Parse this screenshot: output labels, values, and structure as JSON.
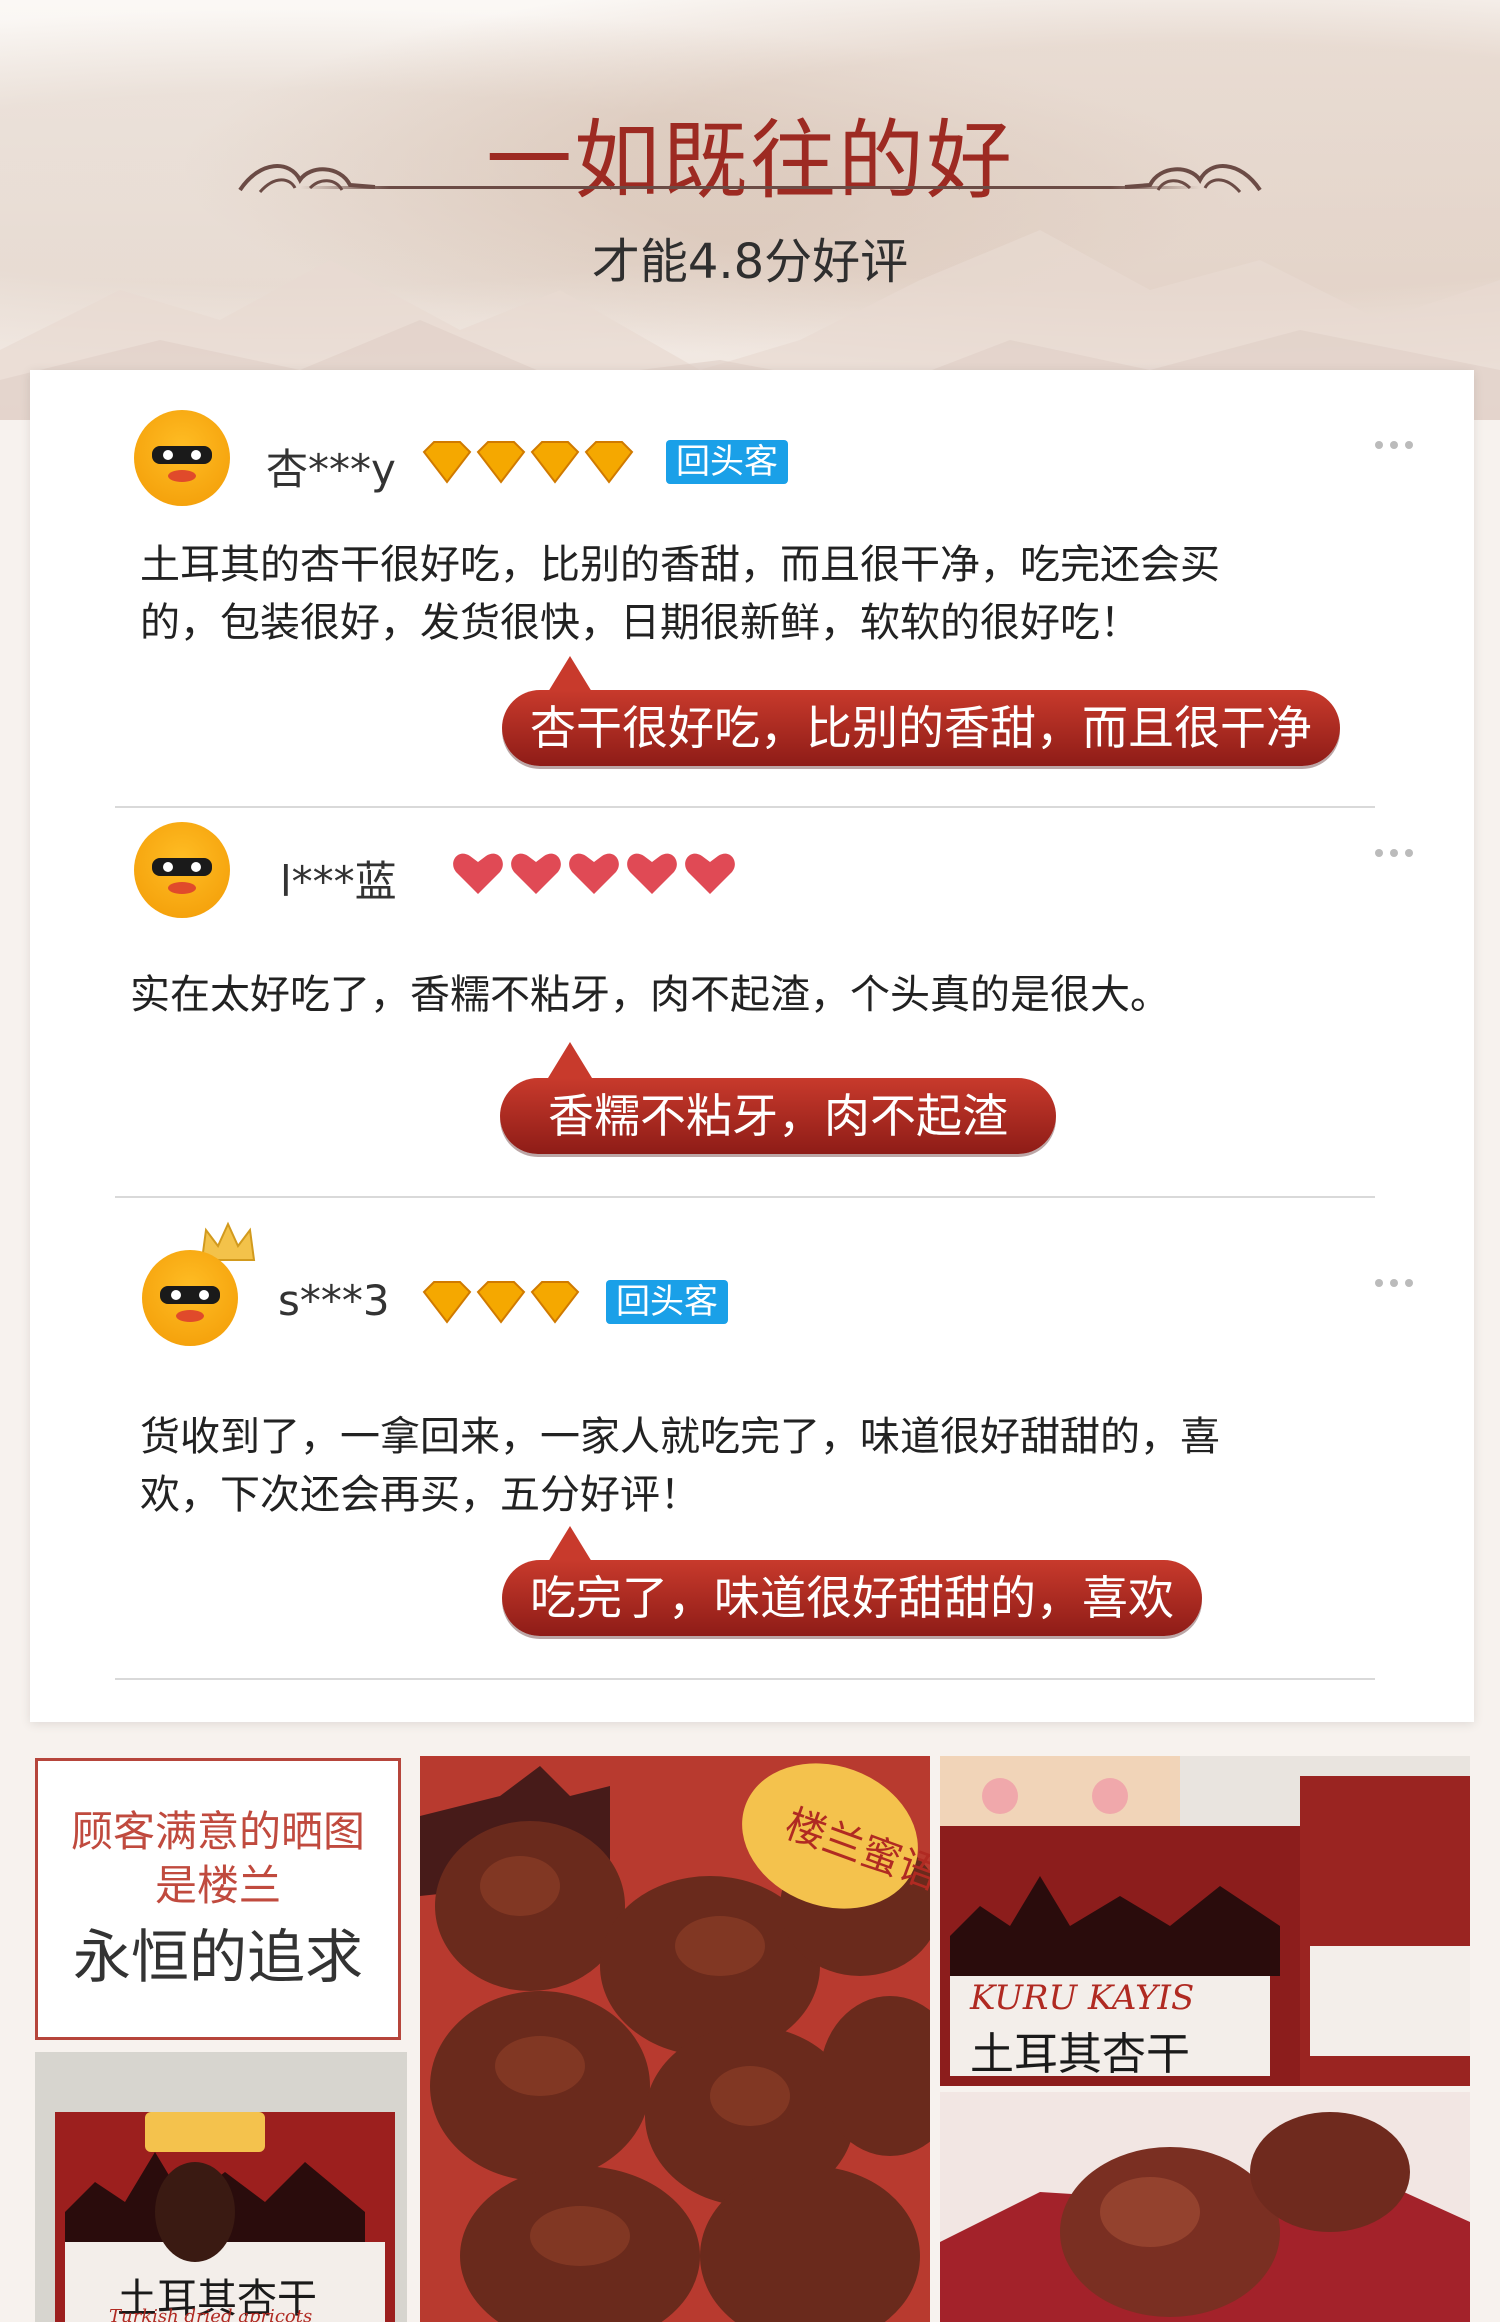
{
  "header": {
    "title": "一如既往的好",
    "subtitle": "才能4.8分好评"
  },
  "reviews": [
    {
      "user": "杏***y",
      "rating_icon": "diamond-icon",
      "rating_count": 4,
      "badge": "回头客",
      "text_line1": "土耳其的杏干很好吃，比别的香甜，而且很干净，吃完还会买",
      "text_line2": "的，包装很好，发货很快，日期很新鲜，软软的很好吃！",
      "highlight": "杏干很好吃，比别的香甜，而且很干净"
    },
    {
      "user": "l***蓝",
      "rating_icon": "heart-icon",
      "rating_count": 5,
      "text_line1": "实在太好吃了，香糯不粘牙，肉不起渣，个头真的是很大。",
      "highlight": "香糯不粘牙，肉不起渣"
    },
    {
      "user": "s***3",
      "rating_icon": "diamond-icon",
      "rating_count": 3,
      "badge": "回头客",
      "text_line1": "货收到了，一拿回来，一家人就吃完了，味道很好甜甜的，喜",
      "text_line2": "欢，下次还会再买，五分好评！",
      "highlight": "吃完了，味道很好甜甜的，喜欢"
    }
  ],
  "gallery": {
    "caption_line1": "顾客满意的晒图",
    "caption_line2": "是楼兰",
    "caption_line3": "永恒的追求",
    "package_brand": "楼兰蜜语",
    "package_product_en": "KURU KAYIS",
    "package_product_cn": "土耳其杏干",
    "package_sub": "Turkish dried apricots"
  },
  "colors": {
    "accent": "#9d2a22",
    "bubble": "#b02a22",
    "badge": "#1aa0e8",
    "diamond": "#f5a800",
    "heart": "#e04a55"
  }
}
